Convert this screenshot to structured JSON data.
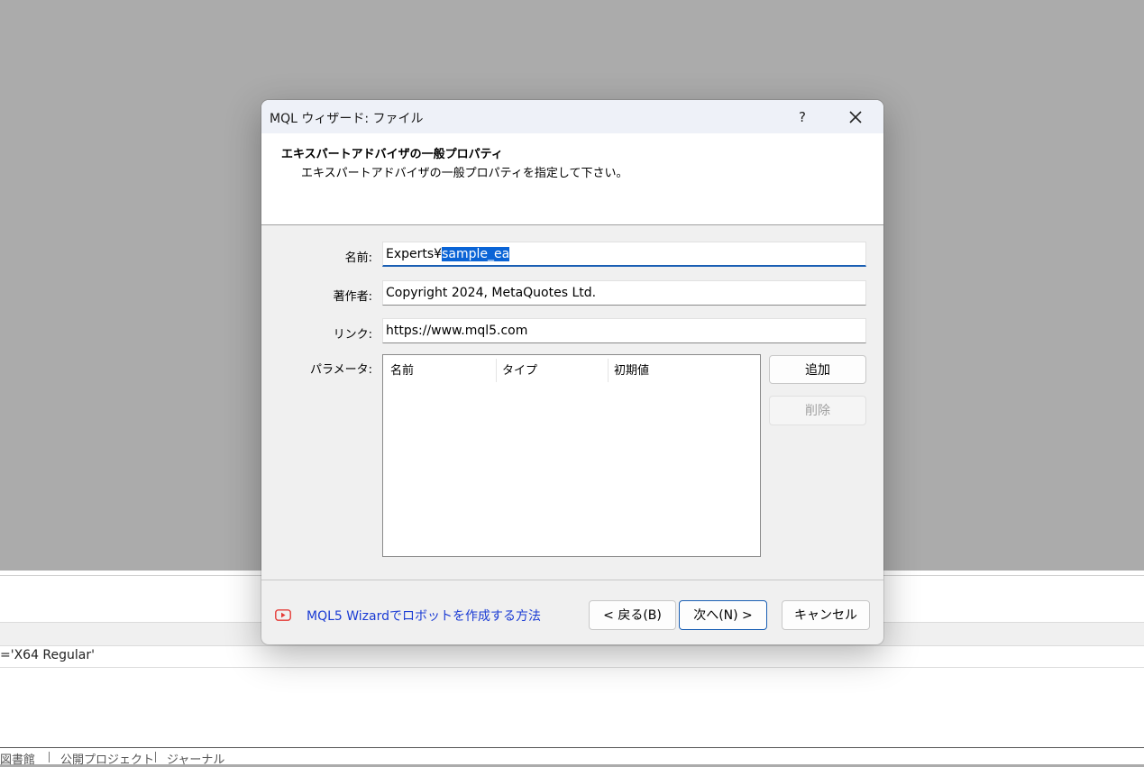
{
  "background": {
    "log_line": "='X64 Regular'",
    "tabs": [
      "図書館",
      "公開プロジェクト",
      "ジャーナル"
    ]
  },
  "dialog": {
    "title": "MQL ウィザード: ファイル",
    "help_label": "?",
    "header": {
      "title": "エキスパートアドバイザの一般プロパティ",
      "subtitle": "エキスパートアドバイザの一般プロパティを指定して下さい。"
    },
    "fields": {
      "name_label": "名前:",
      "name_prefix": "Experts¥",
      "name_selected": "sample_ea",
      "author_label": "著作者:",
      "author_value": "Copyright 2024, MetaQuotes Ltd.",
      "link_label": "リンク:",
      "link_value": "https://www.mql5.com",
      "params_label": "パラメータ:"
    },
    "params_table": {
      "columns": [
        "名前",
        "タイプ",
        "初期値"
      ]
    },
    "buttons": {
      "add": "追加",
      "delete": "削除",
      "back": "< 戻る(B)",
      "next": "次へ(N) >",
      "cancel": "キャンセル"
    },
    "help_link": "MQL5 Wizardでロボットを作成する方法",
    "colors": {
      "selection": "#0a64d6",
      "link": "#1a3bd4",
      "youtube": "#e53935"
    }
  }
}
